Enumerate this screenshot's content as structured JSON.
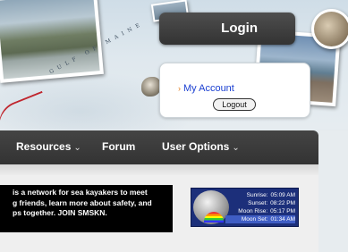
{
  "header": {
    "map_text": "GULF OF MAINE"
  },
  "login": {
    "title": "Login",
    "my_account_label": "My Account",
    "logout_label": "Logout"
  },
  "nav": {
    "items": [
      {
        "label": "Resources",
        "has_dropdown": true
      },
      {
        "label": "Forum",
        "has_dropdown": false
      },
      {
        "label": "User Options",
        "has_dropdown": true
      }
    ]
  },
  "intro": {
    "text": "is a network for sea kayakers to meet\ng friends, learn more about safety, and\nps together. JOIN SMSKN."
  },
  "weather": {
    "rows": [
      {
        "label": "Sunrise:",
        "value": "05:09 AM"
      },
      {
        "label": "Sunset:",
        "value": "08:22 PM"
      },
      {
        "label": "Moon Rise:",
        "value": "05:17 PM"
      },
      {
        "label": "Moon Set:",
        "value": "01:34 AM"
      }
    ]
  },
  "colors": {
    "nav_bg": "#3a3a3a",
    "link": "#1a3fd1",
    "accent_red": "#c0262e",
    "weather_bg": "#1c2f7a"
  }
}
